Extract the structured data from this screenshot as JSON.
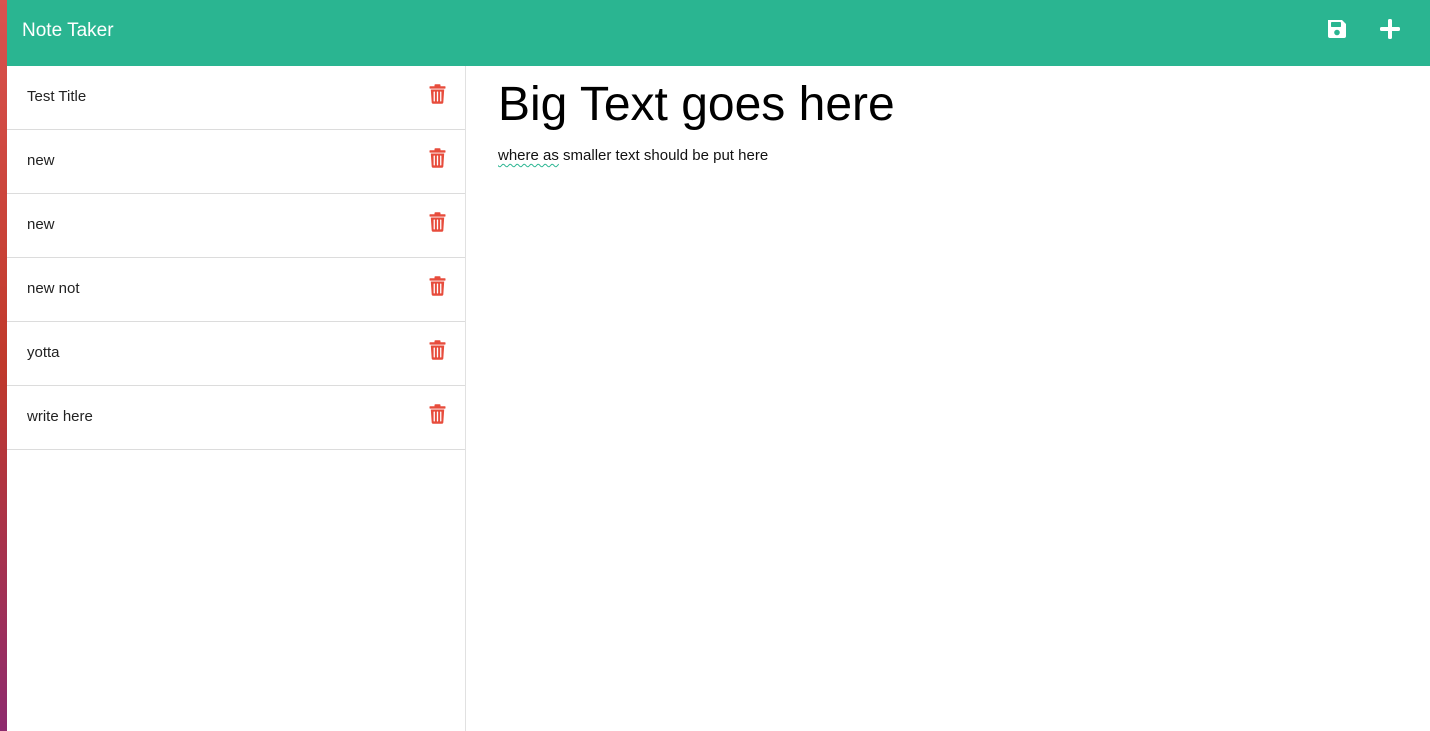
{
  "app": {
    "title": "Note Taker"
  },
  "navbar": {
    "save_icon": "floppy-disk-icon",
    "new_icon": "plus-icon"
  },
  "colors": {
    "navbar": "#2ab591",
    "trash": "#e74c3c",
    "text": "#000000"
  },
  "notes": [
    {
      "title": "Test Title",
      "delete_icon": "trash-icon"
    },
    {
      "title": "new",
      "delete_icon": "trash-icon"
    },
    {
      "title": "new",
      "delete_icon": "trash-icon"
    },
    {
      "title": "new not",
      "delete_icon": "trash-icon"
    },
    {
      "title": "yotta",
      "delete_icon": "trash-icon"
    },
    {
      "title": "write here",
      "delete_icon": "trash-icon"
    }
  ],
  "active_note": {
    "title": "Big Text goes here",
    "body_lead": "where as",
    "body_rest": " smaller text should be put here"
  }
}
